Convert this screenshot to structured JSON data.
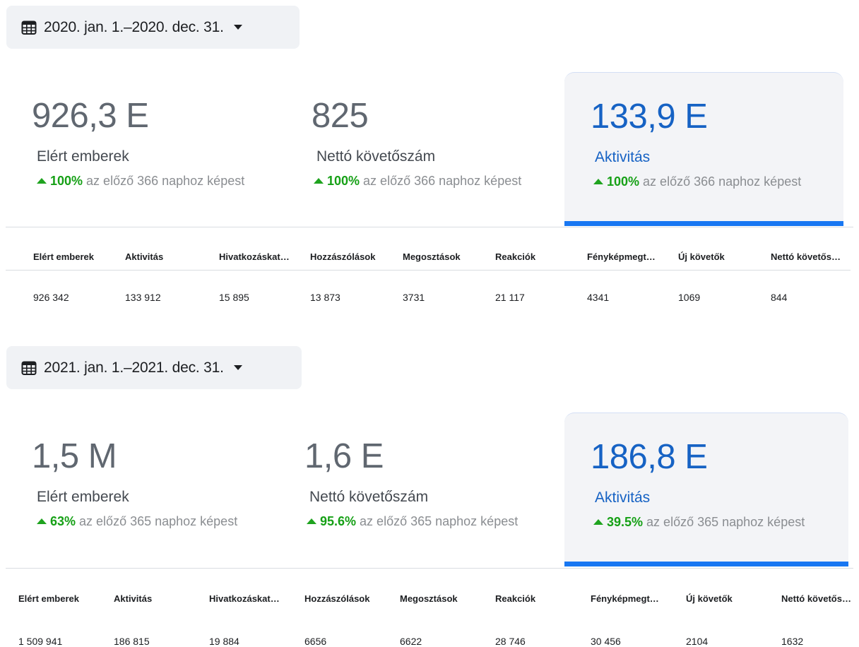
{
  "periods": [
    {
      "date_range": "2020. jan. 1.–2020. dec. 31.",
      "metrics": [
        {
          "value": "926,3 E",
          "label": "Elért emberek",
          "change": "100%",
          "compare": " az előző 366 naphoz képest"
        },
        {
          "value": "825",
          "label": "Nettó követőszám",
          "change": "100%",
          "compare": " az előző 366 naphoz képest"
        },
        {
          "value": "133,9 E",
          "label": "Aktivitás",
          "change": "100%",
          "compare": " az előző 366 naphoz képest",
          "selected": true
        }
      ],
      "table": {
        "headers": [
          "Elért emberek",
          "Aktivitás",
          "Hivatkozáskat…",
          "Hozzászólások",
          "Megosztások",
          "Reakciók",
          "Fényképmegt…",
          "Új követők",
          "Nettó követős…"
        ],
        "values": [
          "926 342",
          "133 912",
          "15 895",
          "13 873",
          "3731",
          "21 117",
          "4341",
          "1069",
          "844"
        ]
      }
    },
    {
      "date_range": "2021. jan. 1.–2021. dec. 31.",
      "metrics": [
        {
          "value": "1,5 M",
          "label": "Elért emberek",
          "change": "63%",
          "compare": " az előző 365 naphoz képest"
        },
        {
          "value": "1,6 E",
          "label": "Nettó követőszám",
          "change": "95.6%",
          "compare": " az előző 365 naphoz képest"
        },
        {
          "value": "186,8 E",
          "label": "Aktivitás",
          "change": "39.5%",
          "compare": " az előző 365 naphoz képest",
          "selected": true
        }
      ],
      "table": {
        "headers": [
          "Elért emberek",
          "Aktivitás",
          "Hivatkozáskat…",
          "Hozzászólások",
          "Megosztások",
          "Reakciók",
          "Fényképmegt…",
          "Új követők",
          "Nettó követős…"
        ],
        "values": [
          "1 509 941",
          "186 815",
          "19 884",
          "6656",
          "6622",
          "28 746",
          "30 456",
          "2104",
          "1632"
        ]
      }
    }
  ],
  "icons": {
    "date_picker": "calendar-icon",
    "dropdown": "caret-down-icon",
    "trend": "triangle-up-icon"
  },
  "colors": {
    "accent": "#1877f2",
    "selected_text": "#1662c4",
    "trend_up": "#16a016",
    "panel_bg": "#f3f4f7"
  }
}
